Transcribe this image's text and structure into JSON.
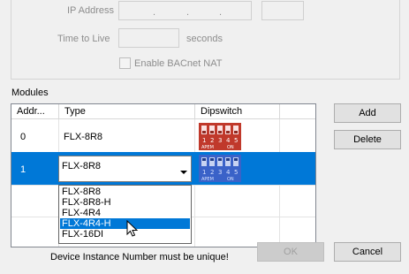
{
  "network": {
    "ip_label": "IP Address",
    "ttl_label": "Time to Live",
    "ttl_unit": "seconds",
    "nat_label": "Enable BACnet NAT"
  },
  "modules": {
    "title": "Modules",
    "columns": [
      "Addr...",
      "Type",
      "Dipswitch"
    ],
    "rows": [
      {
        "addr": "0",
        "type": "FLX-8R8"
      },
      {
        "addr": "1",
        "type": "FLX-8R8"
      }
    ],
    "dipswitch_numbers": [
      "1",
      "2",
      "3",
      "4",
      "5"
    ],
    "dipswitch_marks": [
      "APEM",
      "ON"
    ],
    "type_options": [
      "FLX-8R8",
      "FLX-8R8-H",
      "FLX-4R4",
      "FLX-4R4-H",
      "FLX-16DI"
    ],
    "hovered_option": "FLX-4R4-H"
  },
  "buttons": {
    "add": "Add",
    "delete": "Delete",
    "ok": "OK",
    "cancel": "Cancel"
  },
  "warning": "Device Instance Number must be unique!",
  "colors": {
    "selection": "#0078d7",
    "dip_red": "#c0392b",
    "dip_blue": "#3a62c8"
  },
  "icons": {
    "dropdown": "chevron-down-icon",
    "cursor": "mouse-pointer-icon"
  }
}
